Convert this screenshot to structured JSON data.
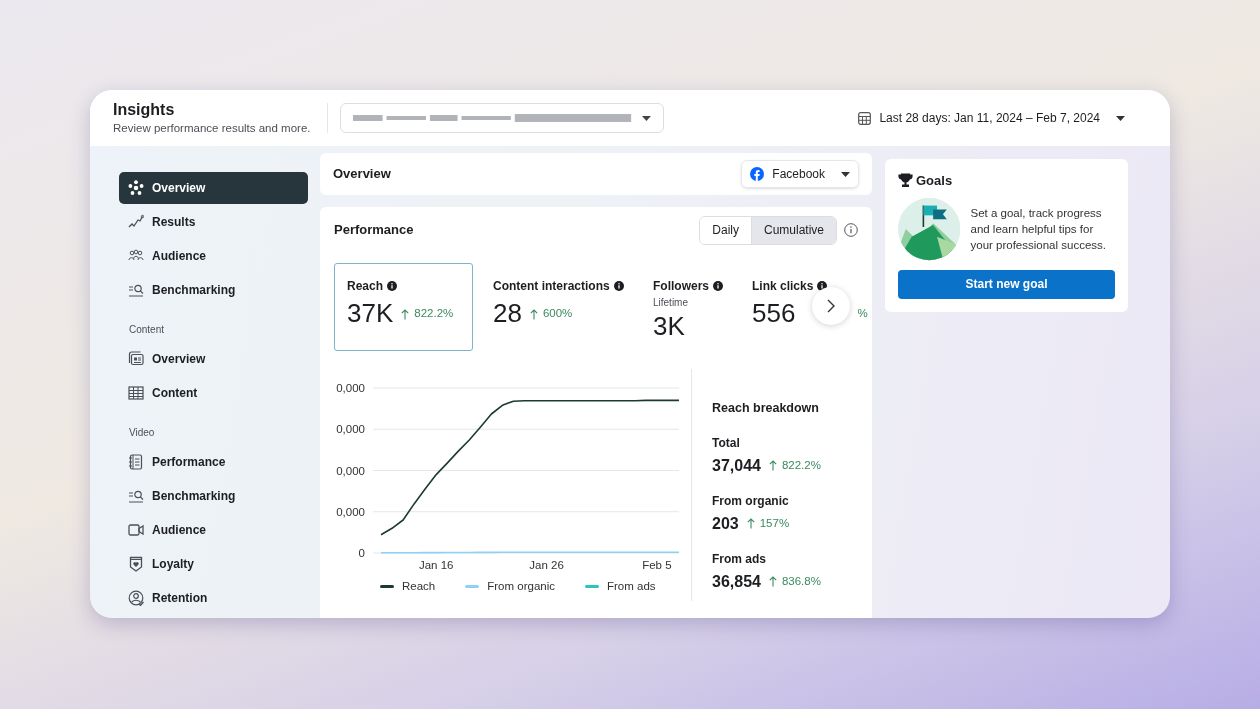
{
  "header": {
    "title": "Insights",
    "subtitle": "Review performance results and more.",
    "date_range": "Last 28 days: Jan 11, 2024 – Feb 7, 2024"
  },
  "sidebar": {
    "sections": [
      {
        "items": [
          {
            "label": "Overview",
            "kind": "hub",
            "selected": true
          },
          {
            "label": "Results",
            "kind": "trend",
            "selected": false
          },
          {
            "label": "Audience",
            "kind": "people",
            "selected": false
          },
          {
            "label": "Benchmarking",
            "kind": "bench",
            "selected": false
          }
        ]
      },
      {
        "heading": "Content",
        "items": [
          {
            "label": "Overview",
            "kind": "cards",
            "selected": false
          },
          {
            "label": "Content",
            "kind": "table",
            "selected": false
          }
        ]
      },
      {
        "heading": "Video",
        "items": [
          {
            "label": "Performance",
            "kind": "notebook",
            "selected": false
          },
          {
            "label": "Benchmarking",
            "kind": "bench",
            "selected": false
          },
          {
            "label": "Audience",
            "kind": "video",
            "selected": false
          },
          {
            "label": "Loyalty",
            "kind": "shield",
            "selected": false
          },
          {
            "label": "Retention",
            "kind": "user",
            "selected": false
          }
        ]
      }
    ]
  },
  "overview": {
    "title": "Overview",
    "platform": "Facebook"
  },
  "performance": {
    "title": "Performance",
    "modes": [
      {
        "label": "Daily",
        "selected": false
      },
      {
        "label": "Cumulative",
        "selected": true
      }
    ],
    "metrics": [
      {
        "label": "Reach",
        "value": "37K",
        "change": "822.2%",
        "rising": true,
        "selected": true
      },
      {
        "label": "Content interactions",
        "value": "28",
        "change": "600%",
        "rising": true,
        "selected": false
      },
      {
        "label": "Followers",
        "sublabel": "Lifetime",
        "value": "3K",
        "selected": false
      },
      {
        "label": "Link clicks",
        "value": "556",
        "change": "%",
        "selected": false
      }
    ],
    "chart": {
      "y_axis_labels": [
        "0,000",
        "0,000",
        "0,000",
        "0,000",
        "0"
      ],
      "x_axis_labels": [
        "Jan 16",
        "Jan 26",
        "Feb 5"
      ],
      "legend": [
        {
          "label": "Reach",
          "color": "#1c3a33"
        },
        {
          "label": "From organic",
          "color": "#8fd0f5"
        },
        {
          "label": "From ads",
          "color": "#2ec4b6"
        }
      ]
    },
    "breakdown": {
      "title": "Reach breakdown",
      "rows": [
        {
          "label": "Total",
          "value": "37,044",
          "change": "822.2%"
        },
        {
          "label": "From organic",
          "value": "203",
          "change": "157%"
        },
        {
          "label": "From ads",
          "value": "36,854",
          "change": "836.8%"
        }
      ]
    }
  },
  "goals": {
    "title": "Goals",
    "text": "Set a goal, track progress and learn helpful tips for your professional success.",
    "button": "Start new goal"
  }
}
